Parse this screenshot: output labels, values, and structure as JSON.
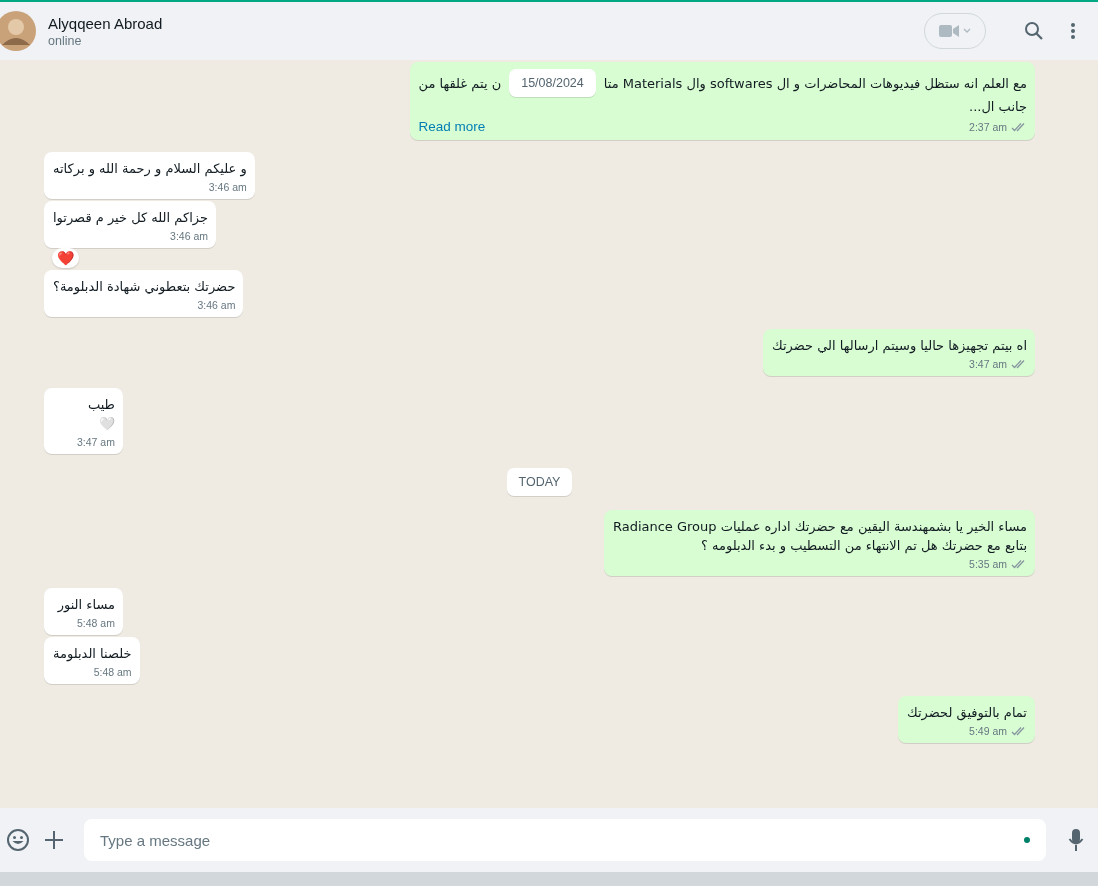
{
  "header": {
    "name": "Alyqqeen Abroad",
    "status": "online"
  },
  "composer": {
    "placeholder": "Type a message"
  },
  "items": [
    {
      "kind": "message",
      "from_me": true,
      "sticky_date": "15/08/2024",
      "lines": [
        {
          "parts": [
            "مع العلم انه ستظل فيديوهات المحاضرات و ال softwares  وال Materials متا",
            "ن يتم غلقها من"
          ]
        },
        "جانب ال..."
      ],
      "read_more": "Read more",
      "time": "2:37 am",
      "read": false
    },
    {
      "kind": "message",
      "from_me": false,
      "lines": [
        "و عليكم السلام و رحمة الله و بركاته"
      ],
      "time": "3:46 am"
    },
    {
      "kind": "message",
      "from_me": false,
      "lines": [
        "جزاكم الله كل خير م قصرتوا"
      ],
      "time": "3:46 am",
      "reaction": "❤️"
    },
    {
      "kind": "message",
      "from_me": false,
      "lines": [
        "حضرتك بتعطوني شهادة الدبلومة؟"
      ],
      "time": "3:46 am"
    },
    {
      "kind": "message",
      "from_me": true,
      "lines": [
        "اه بيتم تجهيزها حاليا وسيتم ارسالها الي حضرتك"
      ],
      "time": "3:47 am",
      "read": false
    },
    {
      "kind": "message",
      "from_me": false,
      "lines": [
        "طيب",
        "🤍"
      ],
      "time": "3:47 am"
    },
    {
      "kind": "date",
      "label": "TODAY"
    },
    {
      "kind": "message",
      "from_me": true,
      "lines": [
        "مساء الخير يا بشمهندسة اليقين مع  حضرتك اداره عمليات Radiance Group",
        "بتابع مع حضرتك هل تم الانتهاء من التسطيب و بدء الدبلومه ؟"
      ],
      "time": "5:35 am",
      "read": false
    },
    {
      "kind": "message",
      "from_me": false,
      "lines": [
        "مساء النور"
      ],
      "time": "5:48 am"
    },
    {
      "kind": "message",
      "from_me": false,
      "lines": [
        "خلصنا الدبلومة"
      ],
      "time": "5:48 am"
    },
    {
      "kind": "message",
      "from_me": true,
      "lines": [
        "تمام بالتوفيق لحضرتك"
      ],
      "time": "5:49 am",
      "read": false
    }
  ]
}
